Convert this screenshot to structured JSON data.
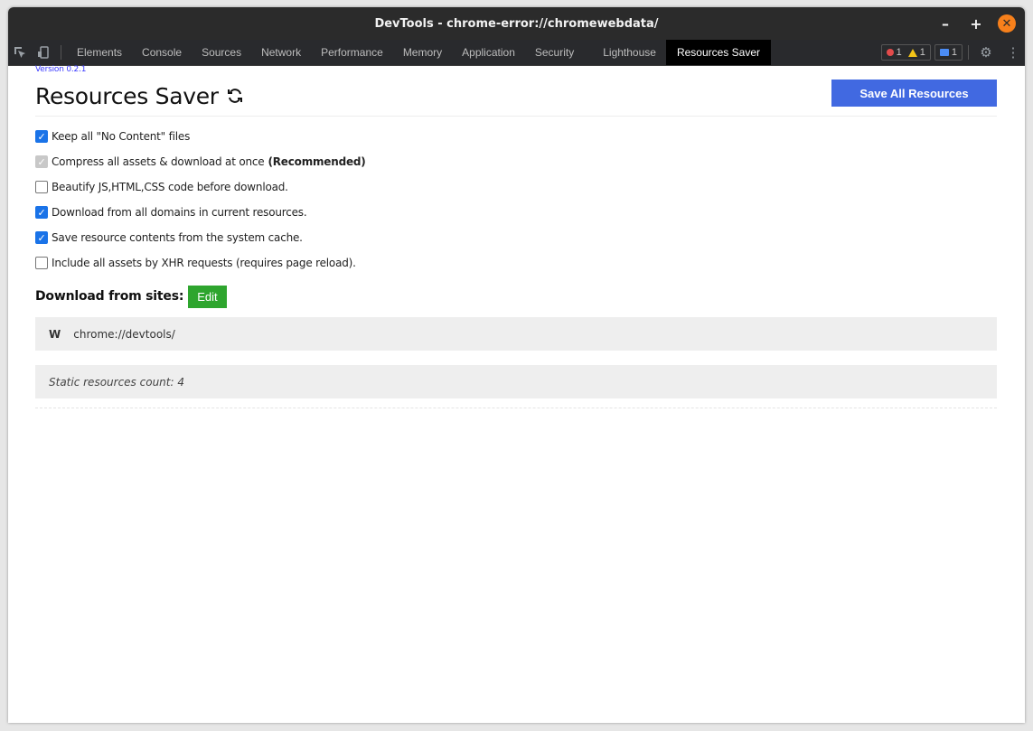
{
  "window": {
    "title": "DevTools - chrome-error://chromewebdata/",
    "controls": {
      "minimize": "–",
      "maximize": "+",
      "close": "✕"
    }
  },
  "toolbar": {
    "tabs": [
      "Elements",
      "Console",
      "Sources",
      "Network",
      "Performance",
      "Memory",
      "Application",
      "Security",
      "Lighthouse",
      "Resources Saver"
    ],
    "active_tab": "Resources Saver",
    "errors": "1",
    "warnings": "1",
    "messages": "1"
  },
  "colors": {
    "accent": "#4169e1",
    "edit": "#2ea52e",
    "checkbox": "#1a73e8",
    "version": "#3b3bff"
  },
  "panel": {
    "version": "Version 0.2.1",
    "title": "Resources Saver",
    "save_all_label": "Save All Resources",
    "options": [
      {
        "label": "Keep all \"No Content\" files",
        "checked": true,
        "disabled": false,
        "suffix": ""
      },
      {
        "label": "Compress all assets & download at once",
        "checked": true,
        "disabled": true,
        "suffix": "(Recommended)"
      },
      {
        "label": "Beautify JS,HTML,CSS code before download.",
        "checked": false,
        "disabled": false,
        "suffix": ""
      },
      {
        "label": "Download from all domains in current resources.",
        "checked": true,
        "disabled": false,
        "suffix": ""
      },
      {
        "label": "Save resource contents from the system cache.",
        "checked": true,
        "disabled": false,
        "suffix": ""
      },
      {
        "label": "Include all assets by XHR requests (requires page reload).",
        "checked": false,
        "disabled": false,
        "suffix": ""
      }
    ],
    "sites_label": "Download from sites:",
    "edit_label": "Edit",
    "site_letter": "W",
    "site_url": "chrome://devtools/",
    "static_count_text": "Static resources count: 4"
  }
}
